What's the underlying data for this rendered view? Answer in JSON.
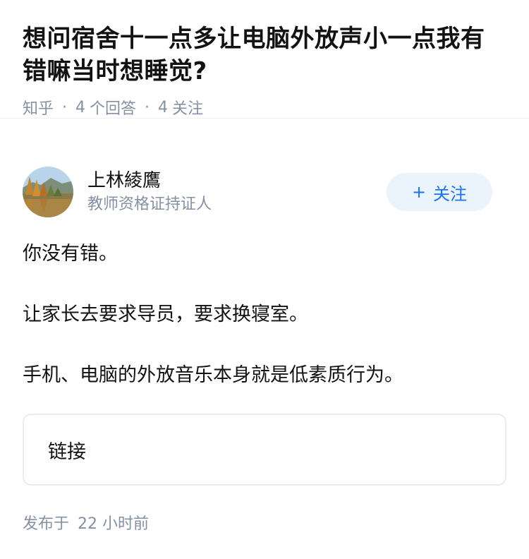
{
  "question": {
    "title": "想问宿舍十一点多让电脑外放声小一点我有错嘛当时想睡觉?",
    "source": "知乎",
    "answer_count": "4",
    "answer_label": "个回答",
    "follow_count": "4",
    "follow_label": "关注"
  },
  "author": {
    "name": "上林綾鷹",
    "badge": "教师资格证持证人",
    "avatar_icon": "avatar-landscape",
    "follow_button": {
      "icon": "+",
      "label": "关注"
    }
  },
  "answer": {
    "paragraphs": [
      "你没有错。",
      "让家长去要求导员，要求换寝室。",
      "手机、电脑的外放音乐本身就是低素质行为。"
    ],
    "link_card_label": "链接"
  },
  "footer": {
    "published_label": "发布于",
    "published_time": "22 小时前"
  },
  "colors": {
    "primary_text": "#121212",
    "secondary_text": "#8590a6",
    "accent": "#1772f6",
    "follow_bg": "#ebf4fc"
  }
}
